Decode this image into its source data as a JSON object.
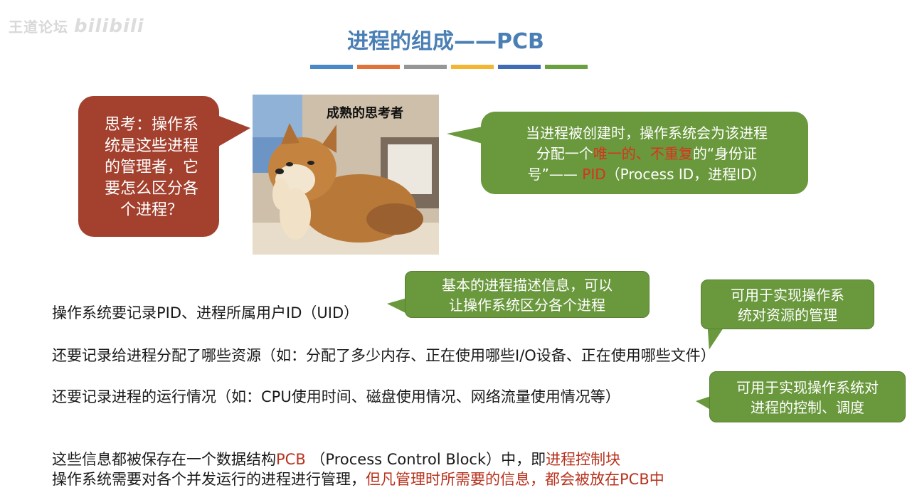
{
  "watermark": {
    "text": "王道论坛",
    "logo": "bilibili"
  },
  "title": "进程的组成——PCB",
  "colors": {
    "title_blue": "#4a7fb5",
    "bubble_red": "#a3402e",
    "bubble_green": "#6a983d",
    "highlight_red": "#d9321f",
    "bars": [
      "#4a89c8",
      "#e0733a",
      "#969696",
      "#f2b632",
      "#3f6cb5",
      "#6aa03f"
    ]
  },
  "thought_bubble": {
    "lines": [
      "思考：操作系",
      "统是这些进程",
      "的管理者，它",
      "要怎么区分各",
      "个进程？"
    ]
  },
  "photo": {
    "caption": "成熟的思考者"
  },
  "pid_bubble": {
    "line1": "当进程被创建时，操作系统会为该进程",
    "line2_pre": "分配一个",
    "line2_red": "唯一的、不重复",
    "line2_post": "的“身份证",
    "line3_pre": "号”—— ",
    "line3_red": "PID",
    "line3_post": "（Process ID，进程ID）"
  },
  "lines": {
    "l1": "操作系统要记录PID、进程所属用户ID（UID）",
    "l2": "还要记录给进程分配了哪些资源（如：分配了多少内存、正在使用哪些I/O设备、正在使用哪些文件）",
    "l3": "还要记录进程的运行情况（如：CPU使用时间、磁盘使用情况、网络流量使用情况等）",
    "l4_pre": "这些信息都被保存在一个数据结构",
    "l4_pcb": "PCB",
    "l4_mid": " （Process Control Block）中，即",
    "l4_red": "进程控制块",
    "l5_pre": "操作系统需要对各个并发运行的进程进行管理，",
    "l5_red": "但凡管理时所需要的信息，都会被放在PCB中"
  },
  "callouts": {
    "c1": [
      "基本的进程描述信息，可以",
      "让操作系统区分各个进程"
    ],
    "c2": [
      "可用于实现操作系",
      "统对资源的管理"
    ],
    "c3": [
      "可用于实现操作系统对",
      "进程的控制、调度"
    ]
  }
}
